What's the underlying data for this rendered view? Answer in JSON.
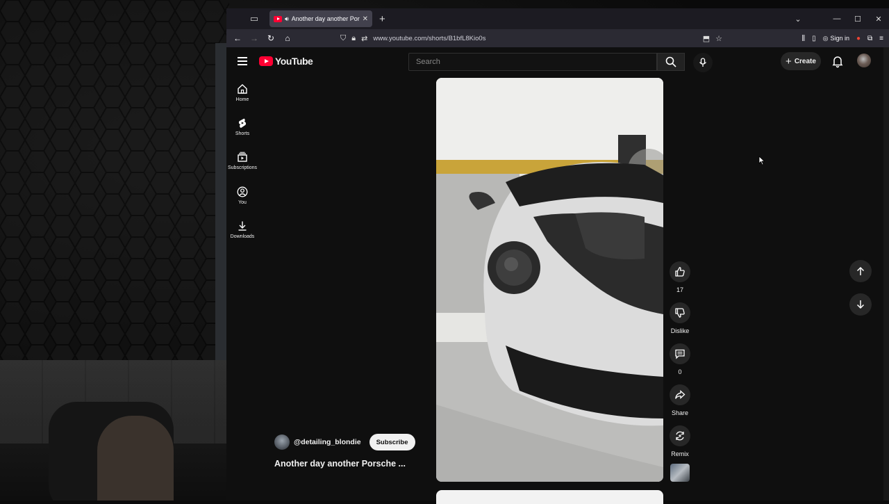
{
  "browser": {
    "tab_title": "Another day another Porsche",
    "url": "www.youtube.com/shorts/B1bfL8Kio0s",
    "sign_in_label": "Sign in"
  },
  "yt": {
    "logo_text": "YouTube",
    "search_placeholder": "Search",
    "create_label": "Create",
    "rail": [
      {
        "label": "Home",
        "icon": "home-icon"
      },
      {
        "label": "Shorts",
        "icon": "shorts-icon"
      },
      {
        "label": "Subscriptions",
        "icon": "subscriptions-icon"
      },
      {
        "label": "You",
        "icon": "you-icon"
      },
      {
        "label": "Downloads",
        "icon": "downloads-icon"
      }
    ],
    "short": {
      "channel": "@detailing_blondie",
      "subscribe_label": "Subscribe",
      "title": "Another day another Porsche ...",
      "like_count": "17",
      "dislike_label": "Dislike",
      "comment_count": "0",
      "share_label": "Share",
      "remix_label": "Remix"
    }
  },
  "colors": {
    "youtube_red": "#ff0033",
    "page_bg": "#0f0f0f",
    "button_bg": "#272727"
  }
}
